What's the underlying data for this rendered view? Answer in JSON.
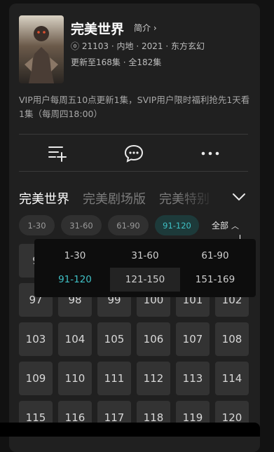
{
  "show": {
    "title": "完美世界",
    "intro_label": "简介",
    "heat": "21103",
    "region": "内地",
    "year": "2021",
    "genre": "东方玄幻",
    "update_status": "更新至168集",
    "total": "全182集",
    "notice": "VIP用户每周五10点更新1集，SVIP用户限时福利抢先1天看1集（每周四18:00）"
  },
  "actions": [
    "playlist-add-icon",
    "comment-icon",
    "more-icon"
  ],
  "tabs": [
    {
      "label": "完美世界",
      "active": true
    },
    {
      "label": "完美剧场版",
      "active": false
    },
    {
      "label": "完美特别",
      "active": false
    }
  ],
  "ranges": [
    {
      "label": "1-30",
      "active": false
    },
    {
      "label": "31-60",
      "active": false
    },
    {
      "label": "61-90",
      "active": false
    },
    {
      "label": "91-120",
      "active": true
    }
  ],
  "all_label": "全部",
  "episodes_row_peek": "97",
  "episodes": [
    [
      "97",
      "98",
      "99",
      "100",
      "101",
      "102"
    ],
    [
      "103",
      "104",
      "105",
      "106",
      "107",
      "108"
    ],
    [
      "109",
      "110",
      "111",
      "112",
      "113",
      "114"
    ],
    [
      "115",
      "116",
      "117",
      "118",
      "119",
      "120"
    ]
  ],
  "peek_first": "9",
  "popup_ranges": [
    {
      "label": "1-30",
      "state": "normal"
    },
    {
      "label": "31-60",
      "state": "normal"
    },
    {
      "label": "61-90",
      "state": "normal"
    },
    {
      "label": "91-120",
      "state": "active"
    },
    {
      "label": "121-150",
      "state": "selected"
    },
    {
      "label": "151-169",
      "state": "normal"
    }
  ],
  "colors": {
    "accent": "#3fc0c5",
    "panel": "#202020",
    "tile": "#333333"
  }
}
